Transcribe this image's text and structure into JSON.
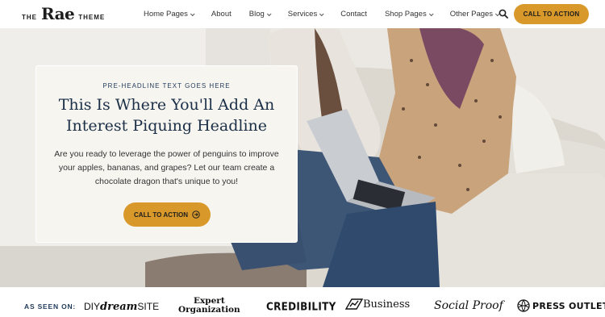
{
  "header": {
    "logo": {
      "prefix": "THE",
      "name": "Rae",
      "suffix": "THEME"
    },
    "nav": [
      {
        "label": "Home Pages",
        "has_dropdown": true
      },
      {
        "label": "About",
        "has_dropdown": false
      },
      {
        "label": "Blog",
        "has_dropdown": true
      },
      {
        "label": "Services",
        "has_dropdown": true
      },
      {
        "label": "Contact",
        "has_dropdown": false
      },
      {
        "label": "Shop Pages",
        "has_dropdown": true
      },
      {
        "label": "Other Pages",
        "has_dropdown": true
      }
    ],
    "search_icon": "search-icon",
    "cta_label": "CALL TO ACTION"
  },
  "hero": {
    "pre_headline": "PRE-HEADLINE TEXT GOES HERE",
    "headline": "This Is Where You'll Add An Interest Piquing Headline",
    "body": "Are you ready to leverage the power of penguins to improve your apples, bananas, and grapes? Let our team create a chocolate dragon that's unique to you!",
    "cta_label": "CALL TO ACTION",
    "cta_icon": "arrow-circle-right-icon"
  },
  "as_seen_on": {
    "label": "AS SEEN ON:",
    "brands": {
      "diy_prefix": "DIY",
      "diy_dream": "dream",
      "diy_site": "SITE",
      "expert_line1": "Expert",
      "expert_line2": "Organization",
      "credibility": "CREDIBILITY",
      "business": "Business",
      "social_proof": "Social Proof",
      "press_outlet": "PRESS OUTLET"
    }
  },
  "colors": {
    "accent": "#d8982a",
    "navy": "#1b2f47",
    "card_bg": "#f7f5f0"
  }
}
